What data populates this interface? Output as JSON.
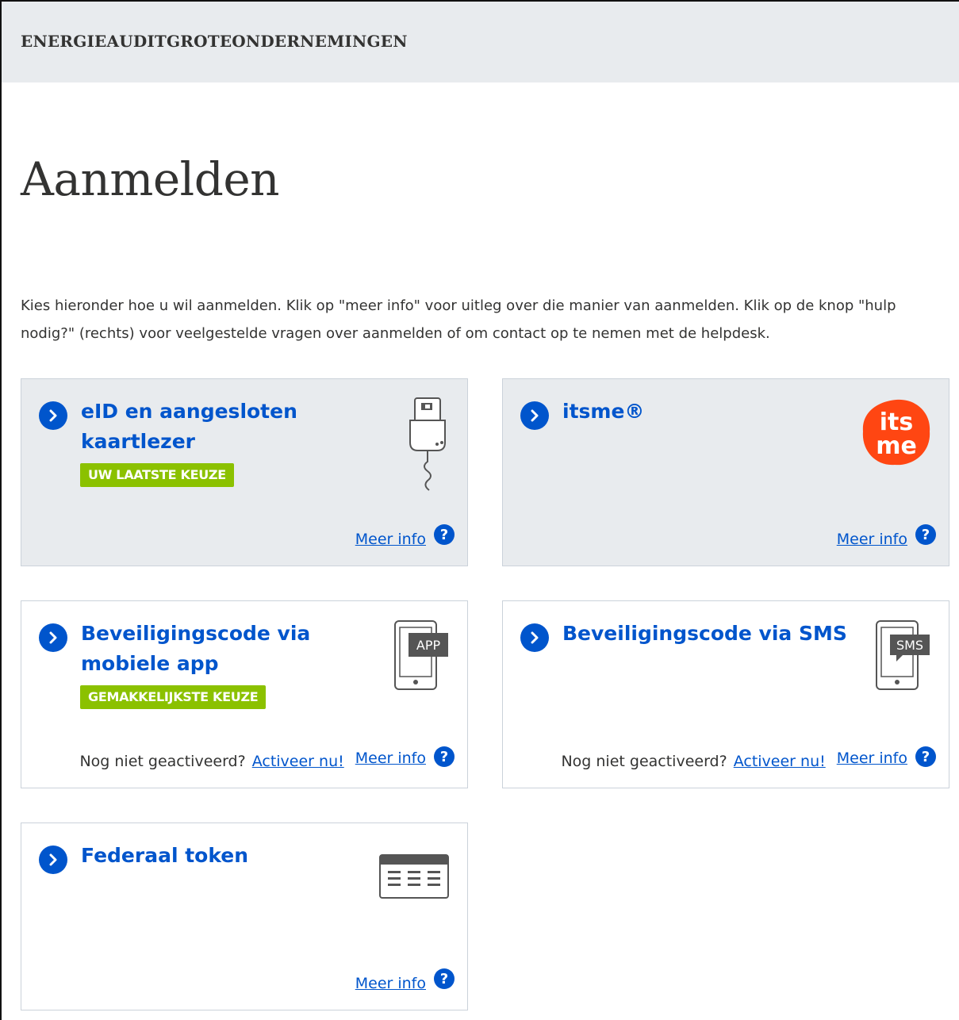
{
  "header": {
    "brand": "ENERGIEAUDITGROTEONDERNEMINGEN"
  },
  "page": {
    "title": "Aanmelden",
    "intro": "Kies hieronder hoe u wil aanmelden. Klik op \"meer info\" voor uitleg over die manier van aanmelden. Klik op de knop \"hulp nodig?\" (rechts) voor veelgestelde vragen over aanmelden of om contact op te nemen met de helpdesk."
  },
  "methods": [
    {
      "title": "eID en aangesloten kaartlezer",
      "badge": "UW LAATSTE KEUZE",
      "meer_info": "Meer info",
      "icon": "card-reader-icon"
    },
    {
      "title": "itsme®",
      "meer_info": "Meer info",
      "icon": "itsme-logo"
    },
    {
      "title": "Beveiligingscode via mobiele app",
      "badge": "GEMAKKELIJKSTE KEUZE",
      "not_activated": "Nog niet geactiveerd?",
      "activate": "Activeer nu!",
      "meer_info": "Meer info",
      "icon": "phone-app-icon",
      "icon_label": "APP"
    },
    {
      "title": "Beveiligingscode via SMS",
      "not_activated": "Nog niet geactiveerd?",
      "activate": "Activeer nu!",
      "meer_info": "Meer info",
      "icon": "phone-sms-icon",
      "icon_label": "SMS"
    },
    {
      "title": "Federaal token",
      "meer_info": "Meer info",
      "icon": "token-icon"
    }
  ],
  "logo_text": {
    "itsme_top": "its",
    "itsme_bottom": "me"
  },
  "help_glyph": "?",
  "colors": {
    "accent": "#0055cc",
    "badge": "#8bc100",
    "card_grey": "#e8ebee",
    "itsme": "#ff4612"
  }
}
